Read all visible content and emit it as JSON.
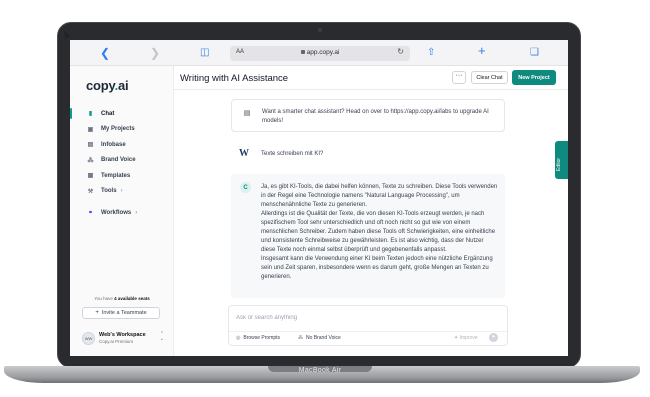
{
  "device": {
    "brand_label": "MacBook Air"
  },
  "browser": {
    "text_size_label": "AA",
    "url": "app.copy.ai"
  },
  "sidebar": {
    "logo_text": "copy",
    "logo_dot": ".",
    "logo_suffix": "ai",
    "items": [
      {
        "label": "Chat",
        "icon": "chat-icon"
      },
      {
        "label": "My Projects",
        "icon": "folder-icon"
      },
      {
        "label": "Infobase",
        "icon": "database-icon"
      },
      {
        "label": "Brand Voice",
        "icon": "soundwave-icon"
      },
      {
        "label": "Templates",
        "icon": "templates-icon"
      },
      {
        "label": "Tools",
        "icon": "tools-icon"
      },
      {
        "label": "Workflows",
        "icon": "workflows-icon"
      }
    ],
    "seats_prefix": "You have",
    "seats_count": "4 available seats",
    "invite_label": "Invite a Teammate",
    "workspace": {
      "initials": "WW",
      "name": "Web's Workspace",
      "plan": "Copy.ai Premium"
    }
  },
  "header": {
    "title": "Writing with AI Assistance",
    "more_label": "···",
    "clear_label": "Clear Chat",
    "new_project_label": "New Project"
  },
  "messages": {
    "notice": "Want a smarter chat assistant? Head on over to https://app.copy.ai/labs to upgrade AI models!",
    "user_avatar": "W",
    "user": "Texte schreiben mit KI?",
    "ai_avatar": "C",
    "ai_paragraphs": [
      "Ja, es gibt KI-Tools, die dabei helfen können, Texte zu schreiben. Diese Tools verwenden in der Regel eine Technologie namens \"Natural Language Processing\", um menschenähnliche Texte zu generieren.",
      "Allerdings ist die Qualität der Texte, die von diesen KI-Tools erzeugt werden, je nach spezifischem Tool sehr unterschiedlich und oft noch nicht so gut wie von einem menschlichen Schreiber. Zudem haben diese Tools oft Schwierigkeiten, eine einheitliche und konsistente Schreibweise zu gewährleisten. Es ist also wichtig, dass der Nutzer diese Texte noch einmal selbst überprüft und gegebenenfalls anpasst.",
      "Insgesamt kann die Verwendung einer KI beim Texten jedoch eine nützliche Ergänzung sein und Zeit sparen, insbesondere wenn es darum geht, große Mengen an Texten zu generieren."
    ]
  },
  "editor_tab": {
    "label": "Editor"
  },
  "composer": {
    "placeholder": "Ask or search anything",
    "browse_label": "Browse Prompts",
    "brand_voice_label": "No Brand Voice",
    "improve_label": "Improve"
  },
  "colors": {
    "accent": "#0f8a7e",
    "accent_light": "#d9f2ef"
  }
}
